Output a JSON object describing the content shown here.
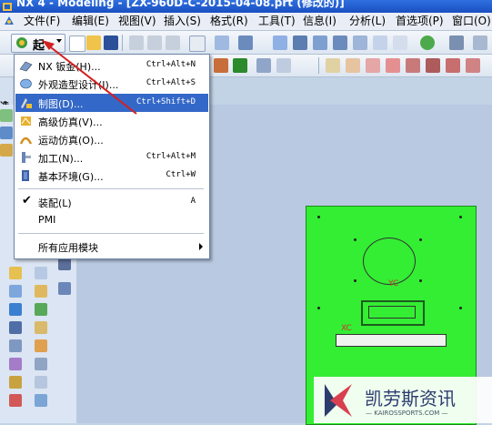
{
  "titlebar": {
    "title": "NX 4 - Modeling - [ZX-960D-C-2015-04-08.prt (修改的)]"
  },
  "menubar": {
    "items": [
      {
        "label": "文件(F)"
      },
      {
        "label": "编辑(E)"
      },
      {
        "label": "视图(V)"
      },
      {
        "label": "插入(S)"
      },
      {
        "label": "格式(R)"
      },
      {
        "label": "工具(T)"
      },
      {
        "label": "信息(I)"
      },
      {
        "label": "分析(L)"
      },
      {
        "label": "首选项(P)"
      },
      {
        "label": "窗口(O)"
      }
    ]
  },
  "toolbar": {
    "start_label": "起"
  },
  "side_tab": "选",
  "start_menu": {
    "items": [
      {
        "label": "NX 钣金(H)...",
        "shortcut": "Ctrl+Alt+N",
        "icon": "sheetmetal-icon"
      },
      {
        "label": "外观造型设计(I)...",
        "shortcut": "Ctrl+Alt+S",
        "icon": "shape-studio-icon"
      },
      {
        "label": "制图(D)...",
        "shortcut": "Ctrl+Shift+D",
        "icon": "drafting-icon",
        "selected": true
      },
      {
        "label": "高级仿真(V)...",
        "shortcut": "",
        "icon": "advanced-simulation-icon"
      },
      {
        "label": "运动仿真(O)...",
        "shortcut": "",
        "icon": "motion-simulation-icon"
      },
      {
        "label": "加工(N)...",
        "shortcut": "Ctrl+Alt+M",
        "icon": "manufacturing-icon"
      },
      {
        "label": "基本环境(G)...",
        "shortcut": "Ctrl+W",
        "icon": "gateway-icon"
      }
    ],
    "assembly": {
      "label": "装配(L)",
      "shortcut": "A"
    },
    "pmi": {
      "label": "PMI"
    },
    "all_apps": {
      "label": "所有应用模块"
    }
  },
  "drawing": {
    "label_top": "YC",
    "label_bottom": "XC"
  },
  "watermark": {
    "name": "凯劳斯资讯",
    "url": "— KAIROSSPORTS.COM —"
  },
  "colors": {
    "sheet": "#33ee33",
    "highlight": "#3468c8",
    "arrow": "#d42020"
  }
}
